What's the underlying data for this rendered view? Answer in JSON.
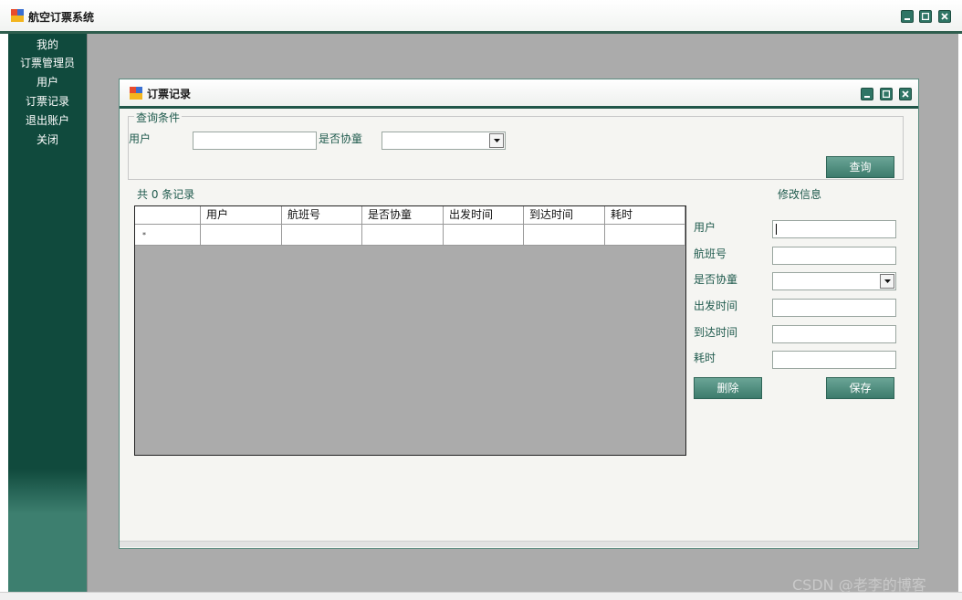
{
  "app": {
    "title": "航空订票系统",
    "controls": {
      "minimize": "minimize-icon",
      "maximize": "maximize-icon",
      "close": "close-icon"
    }
  },
  "sidebar": {
    "items": [
      {
        "label": "我的"
      },
      {
        "label": "订票管理员"
      },
      {
        "label": "用户"
      },
      {
        "label": "订票记录"
      },
      {
        "label": "退出账户"
      },
      {
        "label": "关闭"
      }
    ]
  },
  "child_window": {
    "title": "订票记录",
    "query_group": {
      "legend": "查询条件",
      "user_label": "用户",
      "user_value": "",
      "child_label": "是否协童",
      "child_value": "",
      "query_button": "查询"
    },
    "record_count": "共 0 条记录",
    "grid": {
      "columns": [
        "用户",
        "航班号",
        "是否协童",
        "出发时间",
        "到达时间",
        "耗时"
      ],
      "new_row_marker": "*",
      "rows": []
    },
    "edit_panel": {
      "title": "修改信息",
      "fields": [
        {
          "label": "用户",
          "value": ""
        },
        {
          "label": "航班号",
          "value": ""
        },
        {
          "label": "是否协童",
          "value": ""
        },
        {
          "label": "出发时间",
          "value": ""
        },
        {
          "label": "到达时间",
          "value": ""
        },
        {
          "label": "耗时",
          "value": ""
        }
      ],
      "delete_button": "删除",
      "save_button": "保存"
    }
  },
  "watermark": "CSDN @老李的博客",
  "colors": {
    "sidebar": "#104a3d",
    "accent": "#3d7b6c",
    "label_text": "#1f5a4d",
    "mdi_background": "#ababab"
  }
}
